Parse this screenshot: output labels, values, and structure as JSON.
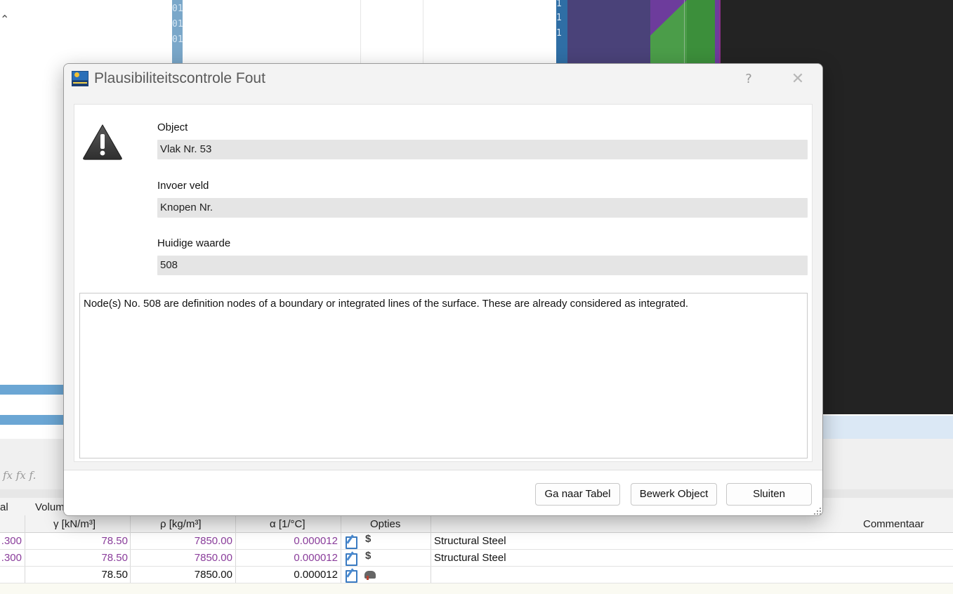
{
  "dialog": {
    "title": "Plausibiliteitscontrole Fout",
    "help_glyph": "?",
    "close_glyph": "✕",
    "object_label": "Object",
    "object_value": "Vlak Nr. 53",
    "input_field_label": "Invoer veld",
    "input_field_value": "Knopen Nr.",
    "current_value_label": "Huidige waarde",
    "current_value": "508",
    "message": "Node(s) No. 508 are definition nodes of a boundary or integrated lines of the surface. These are already considered as integrated.",
    "buttons": {
      "goto_table": "Ga naar Tabel",
      "edit_object": "Bewerk Object",
      "close": "Sluiten"
    },
    "icons": {
      "app": "rfem-app-icon",
      "warning": "warning-triangle-icon"
    }
  },
  "background": {
    "column_digits": [
      "01",
      "01",
      "01"
    ],
    "bluebar_digits": [
      "1",
      "1",
      "1",
      "1"
    ],
    "formula_text": "fx  fx  f.",
    "table": {
      "headers": {
        "material": "al",
        "volume": "Volum",
        "gamma": "γ [kN/m³]",
        "rho": "ρ [kg/m³]",
        "alpha": "α [1/°C]",
        "options": "Opties",
        "comment": "Commentaar"
      },
      "rows": [
        {
          "lead": ".300",
          "gamma": "78.50",
          "rho": "7850.00",
          "alpha": "0.000012",
          "option2": "$",
          "comment": "Structural Steel",
          "highlight": true
        },
        {
          "lead": ".300",
          "gamma": "78.50",
          "rho": "7850.00",
          "alpha": "0.000012",
          "option2": "$",
          "comment": "Structural Steel",
          "highlight": true
        },
        {
          "lead": "",
          "gamma": "78.50",
          "rho": "7850.00",
          "alpha": "0.000012",
          "option2": "",
          "comment": "",
          "highlight": false
        }
      ]
    }
  },
  "colors": {
    "accent_blue": "#2f6ea5",
    "purple_value": "#8a3d9b",
    "warning_fill": "#4a4a4a"
  }
}
